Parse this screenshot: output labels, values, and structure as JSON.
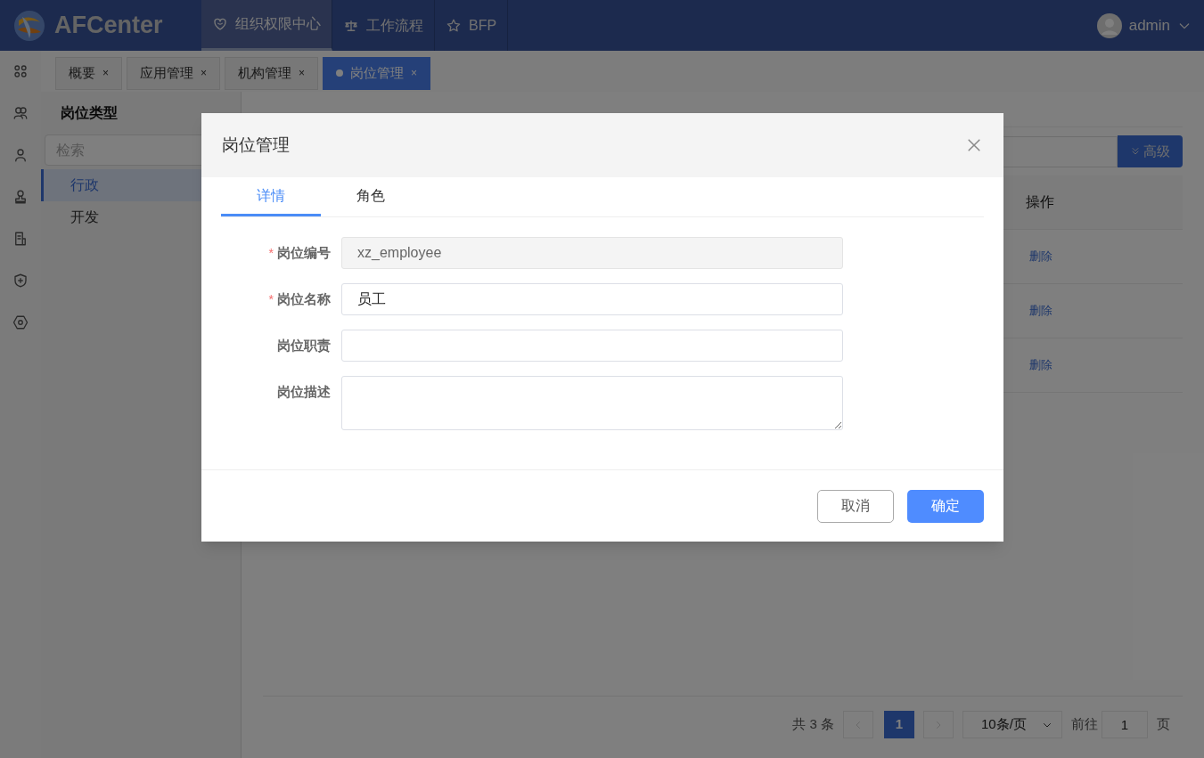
{
  "header": {
    "logo": "AFCenter",
    "nav": [
      {
        "label": "组织权限中心",
        "selected": true
      },
      {
        "label": "工作流程",
        "selected": false
      },
      {
        "label": "BFP",
        "selected": false
      }
    ],
    "user": "admin"
  },
  "page_tabs": [
    {
      "label": "概要",
      "selected": false,
      "close": "×"
    },
    {
      "label": "应用管理",
      "selected": false,
      "close": "×"
    },
    {
      "label": "机构管理",
      "selected": false,
      "close": "×"
    },
    {
      "label": "岗位管理",
      "selected": true,
      "close": "×"
    }
  ],
  "left_panel": {
    "title": "岗位类型",
    "search_placeholder": "检索",
    "items": [
      {
        "label": "行政",
        "selected": true
      },
      {
        "label": "开发",
        "selected": false
      }
    ]
  },
  "right_panel": {
    "advanced_button": "高级",
    "table": {
      "columns": [
        "操作"
      ],
      "rows": [
        {
          "action": "删除"
        },
        {
          "action": "删除"
        },
        {
          "action": "删除"
        }
      ]
    },
    "pagination": {
      "total": "共 3 条",
      "current": "1",
      "page_size": "10条/页",
      "goto_label": "前往",
      "goto_value": "1",
      "page_suffix": "页"
    }
  },
  "modal": {
    "title": "岗位管理",
    "tabs": [
      {
        "label": "详情",
        "selected": true
      },
      {
        "label": "角色",
        "selected": false
      }
    ],
    "fields": [
      {
        "label": "岗位编号",
        "required_mark": "*",
        "kind": "readonly",
        "value": "xz_employee"
      },
      {
        "label": "岗位名称",
        "required_mark": "*",
        "kind": "input",
        "value": "员工"
      },
      {
        "label": "岗位职责",
        "kind": "input"
      },
      {
        "label": "岗位描述",
        "kind": "textarea"
      }
    ],
    "buttons": [
      {
        "label": "取消",
        "primary": false
      },
      {
        "label": "确定",
        "primary": true
      }
    ]
  }
}
